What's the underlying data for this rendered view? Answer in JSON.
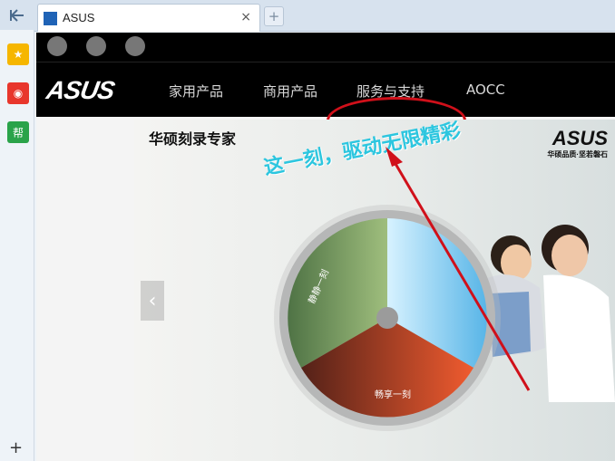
{
  "browser": {
    "tab_title": "ASUS",
    "tab_close": "×",
    "new_tab": "+",
    "sidebar": {
      "back_icon": "back-icon",
      "favorites_icon": "star-icon",
      "weibo_icon": "weibo-icon",
      "help_label": "帮",
      "add": "+"
    }
  },
  "site": {
    "logo": "ASUS",
    "nav": [
      "家用产品",
      "商用产品",
      "服务与支持",
      "AOCC"
    ],
    "highlighted_nav": "服务与支持",
    "social_icons": [
      "weibo-icon",
      "renren-icon",
      "wechat-icon"
    ]
  },
  "banner": {
    "title": "华硕刻录专家",
    "slogan": "这一刻，驱动无限精彩",
    "brand_mark": "ASUS",
    "brand_caption": "华硕品质·坚若磐石",
    "left_arrow": "‹",
    "wheel_labels": [
      "静静一刻",
      "畅享一刻"
    ]
  },
  "colors": {
    "annotation_red": "#d0101a",
    "slogan_cyan": "#2cc6df",
    "nav_bg": "#000000"
  }
}
